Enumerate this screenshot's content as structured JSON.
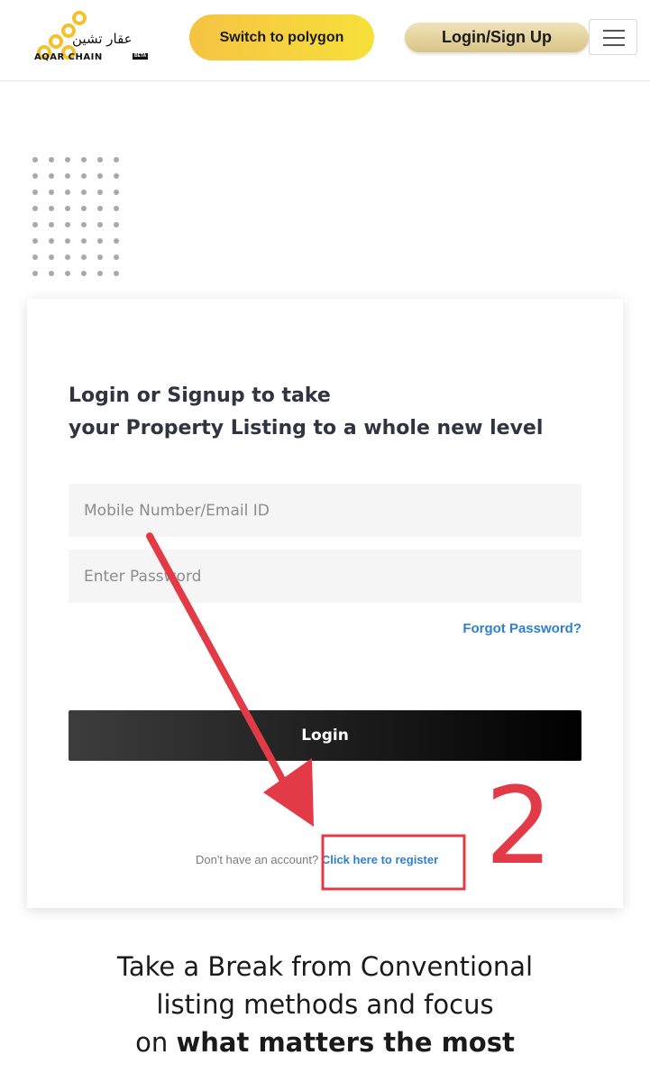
{
  "header": {
    "logo": {
      "arabic": "عقار تشين",
      "english": "AQAR CHAIN",
      "badge": "BETA"
    },
    "switch_label": "Switch to polygon",
    "login_signup_label": "Login/Sign Up",
    "menu_icon": "hamburger-icon"
  },
  "card": {
    "heading_line1": "Login or Signup to take",
    "heading_line2": "your Property Listing to a whole new level",
    "email_placeholder": "Mobile Number/Email ID",
    "password_placeholder": "Enter Password",
    "forgot_label": "Forgot Password?",
    "login_label": "Login",
    "no_account_text": "Don't have an account?",
    "register_label": "Click here to register"
  },
  "annotation": {
    "step_number": "2",
    "color": "#e23b47"
  },
  "tagline": {
    "line1": "Take a Break from Conventional",
    "line2": "listing methods and focus",
    "line3_prefix": "on ",
    "line3_bold": "what matters the most"
  },
  "colors": {
    "accent_yellow": "#f5c343",
    "link_blue": "#2f7fd1",
    "login_button": "#1c1c1c"
  }
}
